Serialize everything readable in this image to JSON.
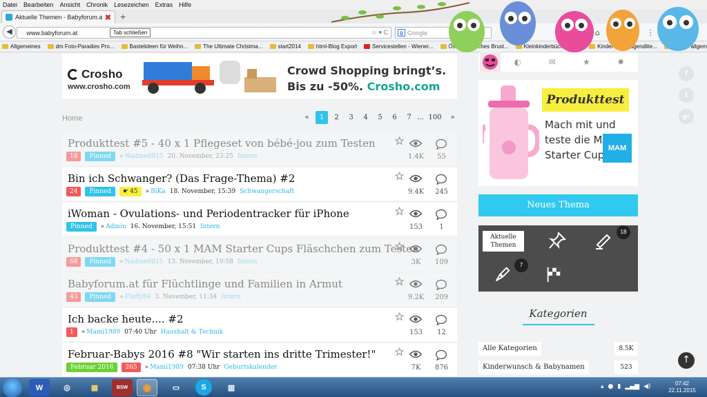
{
  "menu": [
    "Datei",
    "Bearbeiten",
    "Ansicht",
    "Chronik",
    "Lesezeichen",
    "Extras",
    "Hilfe"
  ],
  "tab": {
    "title": "Aktuelle Themen - Babyforum.at",
    "close": "✖",
    "new_tab": "+"
  },
  "tooltip": "Tab schließen",
  "url": "www.babyforum.at",
  "url_buttons": "☆ ▾ C",
  "search_placeholder": "Google",
  "nav_icons": [
    "⌂",
    "⬇",
    "✉",
    "➤",
    "⋮"
  ],
  "bookmarks": [
    "Allgemeines",
    "dm Foto-Paradies Pro...",
    "Bastelideen für Weihn...",
    "The Ultimate Christma...",
    "start2014",
    "html-Blog Export",
    "Servicestellen - Wiener...",
    "Österreichisches Brust...",
    "Kleinkinderbücher - 3 ...",
    "Kinder- und Jugendlite...",
    "Schule allgemein"
  ],
  "banner": {
    "brand": "Crosho",
    "url": "www.crosho.com",
    "line1": "Crowd Shopping bringt’s.",
    "line2_prefix": "Bis zu -50%.",
    "line2_brand": "Crosho.com"
  },
  "home_link": "Home",
  "pagination": [
    "«",
    "1",
    "2",
    "3",
    "4",
    "5",
    "6",
    "7",
    "...",
    "100",
    "»"
  ],
  "topics": [
    {
      "title": "Produkttest #5 - 40 x 1 Pflegeset von bébé-jou zum Testen",
      "count": "18",
      "pinned": "Pinned",
      "author": "Nadine0815",
      "date": "20. November, 23:25",
      "category": "Intern",
      "views": "1.4K",
      "replies": "55"
    },
    {
      "title": "Bin ich Schwanger? (Das Frage-Thema) #2",
      "count": "24",
      "pinned": "Pinned",
      "hot": "45",
      "author": "BiKa",
      "date": "18. November, 15:39",
      "category": "Schwangerschaft",
      "views": "9.4K",
      "replies": "245"
    },
    {
      "title": "iWoman - Ovulations- und Periodentracker für iPhone",
      "pinned": "Pinned",
      "author": "Admin",
      "date": "16. November, 15:51",
      "category": "Intern",
      "views": "153",
      "replies": "1"
    },
    {
      "title": "Produkttest #4 - 50 x 1 MAM Starter Cups Fläschchen zum Testen",
      "count": "68",
      "pinned": "Pinned",
      "author": "Nadine0815",
      "date": "13. November, 19:58",
      "category": "Intern",
      "views": "3K",
      "replies": "109"
    },
    {
      "title": "Babyforum.at für Flüchtlinge und Familien in Armut",
      "count": "43",
      "pinned": "Pinned",
      "author": "Fluffy84",
      "date": "3. November, 11:34",
      "category": "Intern",
      "views": "9.2K",
      "replies": "209"
    },
    {
      "title": "Ich backe heute.... #2",
      "count": "1",
      "author": "Mami1989",
      "date": "07:40 Uhr",
      "category": "Haushalt & Technik",
      "views": "153",
      "replies": "12"
    },
    {
      "title": "Februar-Babys 2016 #8 \"Wir starten ins dritte Trimester!\"",
      "tag": "Februar 2016",
      "count": "265",
      "author": "Mami1989",
      "date": "07:38 Uhr",
      "category": "Geburtskalender",
      "views": "7K",
      "replies": "876"
    }
  ],
  "sidebar": {
    "icons": [
      "◐",
      "✉",
      "★",
      "✹"
    ],
    "promo": {
      "title": "Produkttest",
      "text": "Mach mit und teste die MAM Starter Cups!",
      "logo": "MAM"
    },
    "new_topic": "Neues Thema",
    "filter": {
      "active_line1": "Aktuelle",
      "active_line2": "Themen",
      "badge_unread": "18",
      "badge_mine": "7"
    },
    "categories_title": "Kategorien",
    "categories": [
      {
        "name": "Alle Kategorien",
        "count": "8.5K"
      },
      {
        "name": "Kinderwunsch & Babynamen",
        "count": "523"
      }
    ]
  },
  "social": [
    "f",
    "t",
    "g+"
  ],
  "scroll_up": "↑",
  "clock": {
    "time": "07:42",
    "date": "22.11.2015"
  },
  "taskbar_apps": [
    "W",
    "◎",
    "▦",
    "BSW",
    "◉",
    "▭",
    "S",
    "▥"
  ]
}
